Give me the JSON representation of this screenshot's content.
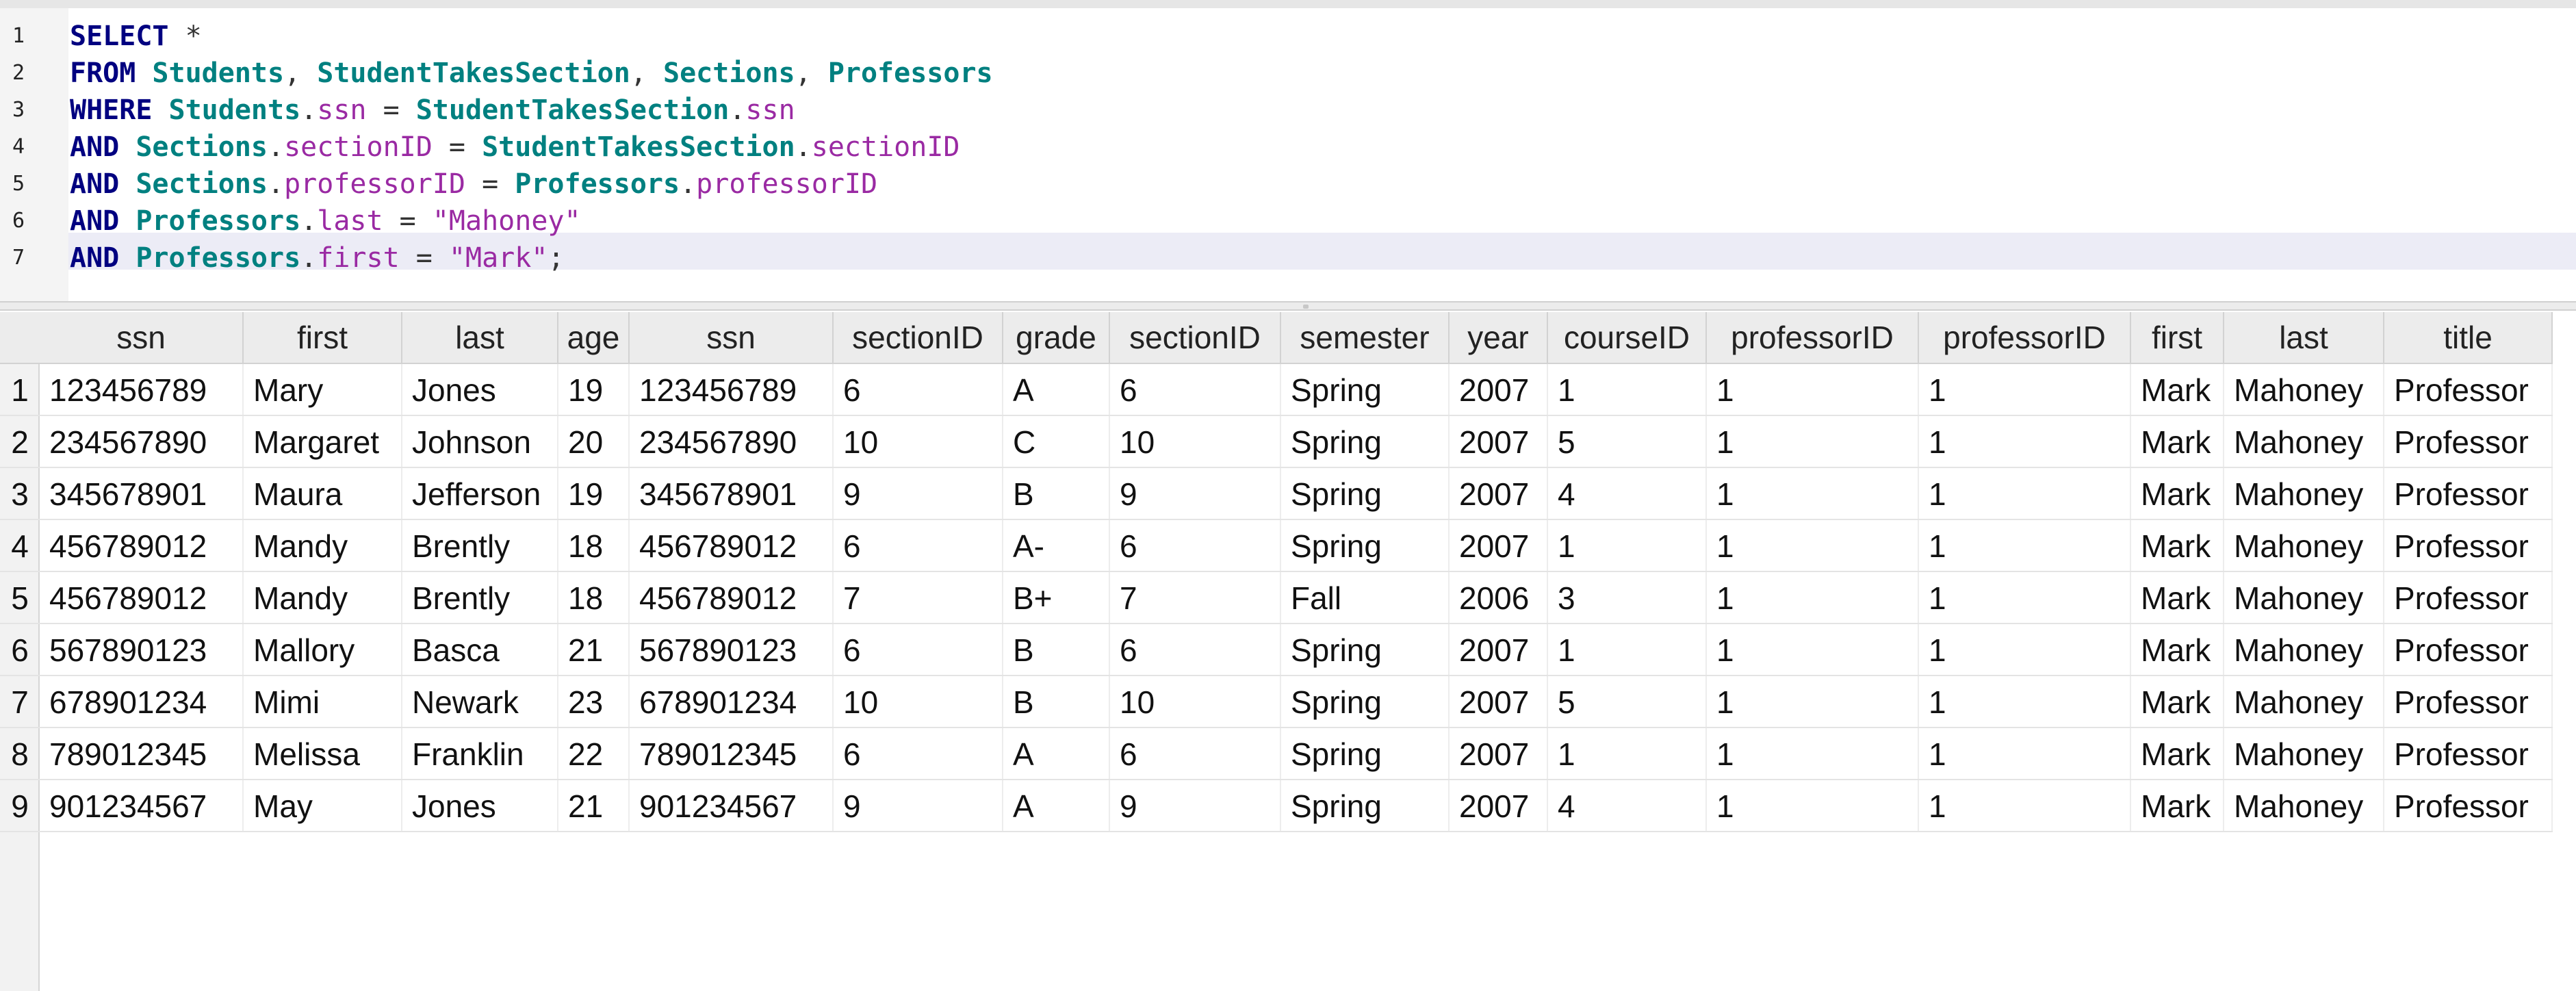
{
  "editor": {
    "line_numbers": [
      "1",
      "2",
      "3",
      "4",
      "5",
      "6",
      "7"
    ],
    "lines": [
      [
        {
          "t": "kw",
          "v": "SELECT"
        },
        {
          "t": "op",
          "v": " *"
        }
      ],
      [
        {
          "t": "kw",
          "v": "FROM"
        },
        {
          "t": "op",
          "v": " "
        },
        {
          "t": "tbl",
          "v": "Students"
        },
        {
          "t": "op",
          "v": ", "
        },
        {
          "t": "tbl",
          "v": "StudentTakesSection"
        },
        {
          "t": "op",
          "v": ", "
        },
        {
          "t": "tbl",
          "v": "Sections"
        },
        {
          "t": "op",
          "v": ", "
        },
        {
          "t": "tbl",
          "v": "Professors"
        }
      ],
      [
        {
          "t": "kw",
          "v": "WHERE"
        },
        {
          "t": "op",
          "v": " "
        },
        {
          "t": "tbl",
          "v": "Students"
        },
        {
          "t": "op",
          "v": "."
        },
        {
          "t": "col",
          "v": "ssn"
        },
        {
          "t": "op",
          "v": " = "
        },
        {
          "t": "tbl",
          "v": "StudentTakesSection"
        },
        {
          "t": "op",
          "v": "."
        },
        {
          "t": "col",
          "v": "ssn"
        }
      ],
      [
        {
          "t": "kw",
          "v": "AND"
        },
        {
          "t": "op",
          "v": " "
        },
        {
          "t": "tbl",
          "v": "Sections"
        },
        {
          "t": "op",
          "v": "."
        },
        {
          "t": "col",
          "v": "sectionID"
        },
        {
          "t": "op",
          "v": " = "
        },
        {
          "t": "tbl",
          "v": "StudentTakesSection"
        },
        {
          "t": "op",
          "v": "."
        },
        {
          "t": "col",
          "v": "sectionID"
        }
      ],
      [
        {
          "t": "kw",
          "v": "AND"
        },
        {
          "t": "op",
          "v": " "
        },
        {
          "t": "tbl",
          "v": "Sections"
        },
        {
          "t": "op",
          "v": "."
        },
        {
          "t": "col",
          "v": "professorID"
        },
        {
          "t": "op",
          "v": " = "
        },
        {
          "t": "tbl",
          "v": "Professors"
        },
        {
          "t": "op",
          "v": "."
        },
        {
          "t": "col",
          "v": "professorID"
        }
      ],
      [
        {
          "t": "kw",
          "v": "AND"
        },
        {
          "t": "op",
          "v": " "
        },
        {
          "t": "tbl",
          "v": "Professors"
        },
        {
          "t": "op",
          "v": "."
        },
        {
          "t": "col",
          "v": "last"
        },
        {
          "t": "op",
          "v": " = "
        },
        {
          "t": "str",
          "v": "\"Mahoney\""
        }
      ],
      [
        {
          "t": "kw",
          "v": "AND"
        },
        {
          "t": "op",
          "v": " "
        },
        {
          "t": "tbl",
          "v": "Professors"
        },
        {
          "t": "op",
          "v": "."
        },
        {
          "t": "col",
          "v": "first"
        },
        {
          "t": "op",
          "v": " = "
        },
        {
          "t": "str",
          "v": "\"Mark\""
        },
        {
          "t": "op",
          "v": ";"
        }
      ]
    ]
  },
  "results": {
    "columns": [
      "ssn",
      "first",
      "last",
      "age",
      "ssn",
      "sectionID",
      "grade",
      "sectionID",
      "semester",
      "year",
      "courseID",
      "professorID",
      "professorID",
      "first",
      "last",
      "title"
    ],
    "row_numbers": [
      "1",
      "2",
      "3",
      "4",
      "5",
      "6",
      "7",
      "8",
      "9"
    ],
    "rows": [
      [
        "123456789",
        "Mary",
        "Jones",
        "19",
        "123456789",
        "6",
        "A",
        "6",
        "Spring",
        "2007",
        "1",
        "1",
        "1",
        "Mark",
        "Mahoney",
        "Professor"
      ],
      [
        "234567890",
        "Margaret",
        "Johnson",
        "20",
        "234567890",
        "10",
        "C",
        "10",
        "Spring",
        "2007",
        "5",
        "1",
        "1",
        "Mark",
        "Mahoney",
        "Professor"
      ],
      [
        "345678901",
        "Maura",
        "Jefferson",
        "19",
        "345678901",
        "9",
        "B",
        "9",
        "Spring",
        "2007",
        "4",
        "1",
        "1",
        "Mark",
        "Mahoney",
        "Professor"
      ],
      [
        "456789012",
        "Mandy",
        "Brently",
        "18",
        "456789012",
        "6",
        "A-",
        "6",
        "Spring",
        "2007",
        "1",
        "1",
        "1",
        "Mark",
        "Mahoney",
        "Professor"
      ],
      [
        "456789012",
        "Mandy",
        "Brently",
        "18",
        "456789012",
        "7",
        "B+",
        "7",
        "Fall",
        "2006",
        "3",
        "1",
        "1",
        "Mark",
        "Mahoney",
        "Professor"
      ],
      [
        "567890123",
        "Mallory",
        "Basca",
        "21",
        "567890123",
        "6",
        "B",
        "6",
        "Spring",
        "2007",
        "1",
        "1",
        "1",
        "Mark",
        "Mahoney",
        "Professor"
      ],
      [
        "678901234",
        "Mimi",
        "Newark",
        "23",
        "678901234",
        "10",
        "B",
        "10",
        "Spring",
        "2007",
        "5",
        "1",
        "1",
        "Mark",
        "Mahoney",
        "Professor"
      ],
      [
        "789012345",
        "Melissa",
        "Franklin",
        "22",
        "789012345",
        "6",
        "A",
        "6",
        "Spring",
        "2007",
        "1",
        "1",
        "1",
        "Mark",
        "Mahoney",
        "Professor"
      ],
      [
        "901234567",
        "May",
        "Jones",
        "21",
        "901234567",
        "9",
        "A",
        "9",
        "Spring",
        "2007",
        "4",
        "1",
        "1",
        "Mark",
        "Mahoney",
        "Professor"
      ]
    ]
  }
}
